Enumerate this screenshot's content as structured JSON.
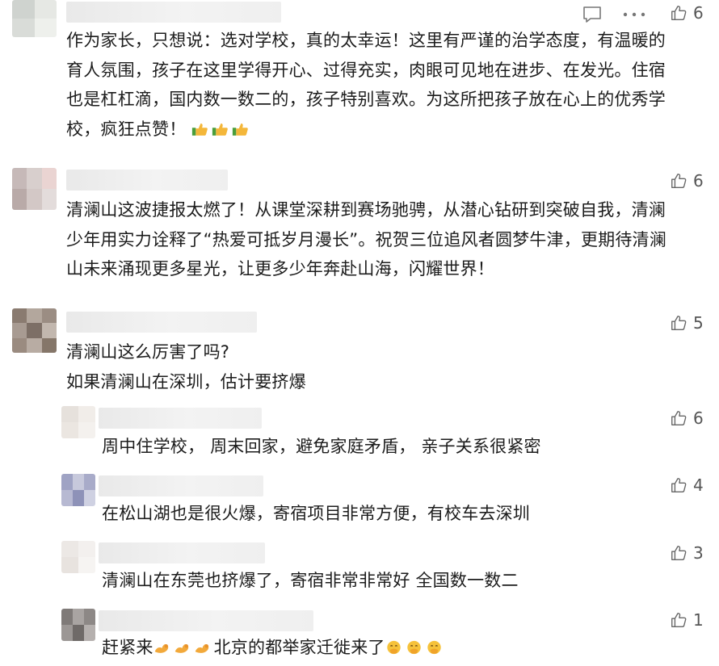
{
  "comments": [
    {
      "likes": "6",
      "lines": [
        "作为家长，只想说：选对学校，真的太幸运！这里有严谨的治学态度，有温暖的",
        "育人氛围，孩子在这里学得开心、过得充实，肉眼可见地在进步、在发光。住宿",
        "也是杠杠滴，国内数一数二的，孩子特别喜欢。为这所把孩子放在心上的优秀学",
        "校，疯狂点赞！"
      ],
      "emoji": [
        "thumbs-up-emoji",
        "thumbs-up-emoji",
        "thumbs-up-emoji"
      ]
    },
    {
      "likes": "6",
      "lines": [
        "清澜山这波捷报太燃了！从课堂深耕到赛场驰骋，从潜心钻研到突破自我，清澜",
        "少年用实力诠释了“热爱可抵岁月漫长”。祝贺三位追风者圆梦牛津，更期待清澜",
        "山未来涌现更多星光，让更多少年奔赴山海，闪耀世界！"
      ]
    },
    {
      "likes": "5",
      "lines": [
        "清澜山这么厉害了吗?",
        "如果清澜山在深圳，估计要挤爆"
      ]
    }
  ],
  "replies": [
    {
      "likes": "6",
      "text": "周中住学校， 周末回家，避免家庭矛盾，  亲子关系很紧密"
    },
    {
      "likes": "4",
      "text": "在松山湖也是很火爆，寄宿项目非常方便，有校车去深圳"
    },
    {
      "likes": "3",
      "text": "清澜山在东莞也挤爆了，寄宿非常非常好  全国数一数二"
    },
    {
      "likes": "1",
      "text_before": "赶紧来",
      "text_after": "北京的都举家迁徙来了"
    }
  ],
  "colors": {
    "text": "#1c1c1c",
    "muted": "#555555",
    "nick_blur": "#ececec"
  }
}
